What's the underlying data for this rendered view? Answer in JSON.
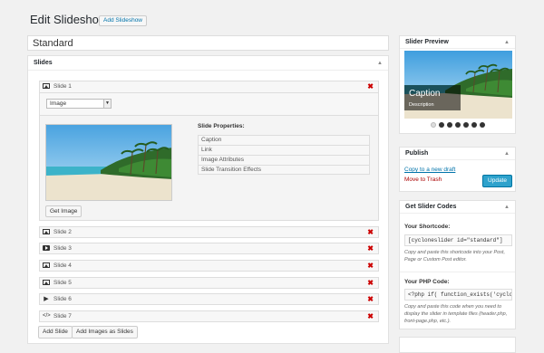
{
  "header": {
    "title": "Edit Slideshow",
    "add_button": "Add Slideshow"
  },
  "slideshow_title": "Standard",
  "slides_panel": {
    "title": "Slides",
    "open_slide": {
      "label": "Slide 1",
      "type_value": "Image",
      "get_image_button": "Get Image",
      "properties_title": "Slide Properties:",
      "properties": [
        "Caption",
        "Link",
        "Image Attributes",
        "Slide Transition Effects"
      ]
    },
    "slides": [
      {
        "label": "Slide 2",
        "icon": "image-icon"
      },
      {
        "label": "Slide 3",
        "icon": "youtube-icon"
      },
      {
        "label": "Slide 4",
        "icon": "image-icon"
      },
      {
        "label": "Slide 5",
        "icon": "image-icon"
      },
      {
        "label": "Slide 6",
        "icon": "play-icon"
      },
      {
        "label": "Slide 7",
        "icon": "code-icon"
      }
    ],
    "add_slide_button": "Add Slide",
    "add_images_button": "Add Images as Slides"
  },
  "preview": {
    "title": "Slider Preview",
    "caption": "Caption",
    "description": "Description",
    "dot_count": 7,
    "active_dot": 0
  },
  "publish": {
    "title": "Publish",
    "copy_link": "Copy to a new draft",
    "trash_link": "Move to Trash",
    "update_button": "Update"
  },
  "codes": {
    "title": "Get Slider Codes",
    "shortcode_label": "Your Shortcode:",
    "shortcode_value": "[cycloneslider id=\"standard\"]",
    "shortcode_help": "Copy and paste this shortcode into your Post, Page or Custom Post editor.",
    "php_label": "Your PHP Code:",
    "php_value": "<?php if( function_exists('cyclone_slider') ) cyclone_slider('standard'); ?>",
    "php_help": "Copy and paste this code when you need to display the slider in template files (header.php, front-page.php, etc.)."
  },
  "colors": {
    "accent": "#2ea2cc",
    "link": "#0073aa",
    "delete": "#cc0000"
  }
}
